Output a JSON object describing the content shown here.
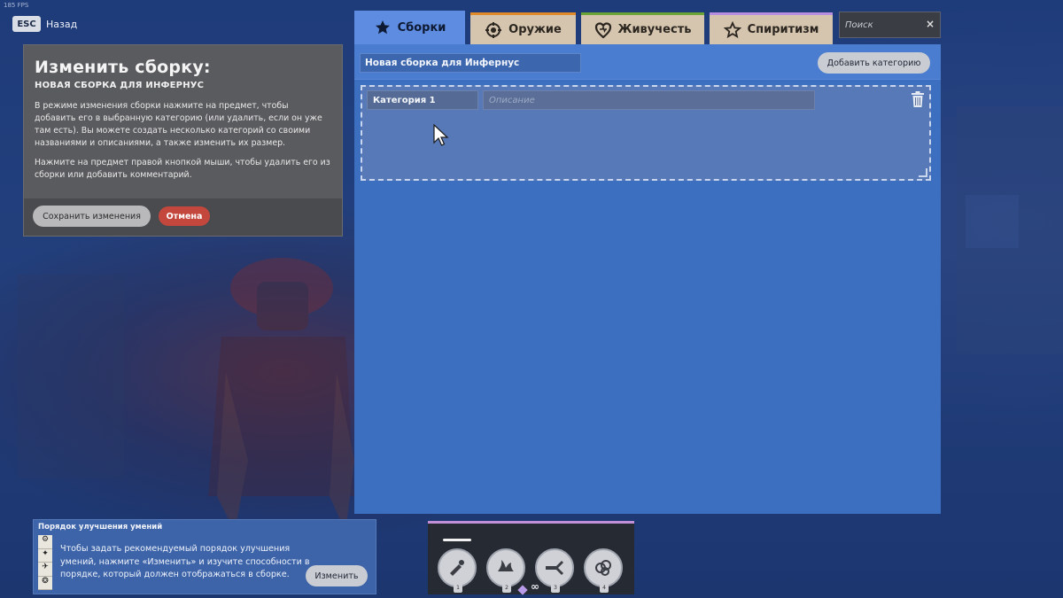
{
  "fps": "185 FPS",
  "back": {
    "key": "ESC",
    "label": "Назад"
  },
  "edit_panel": {
    "title": "Изменить сборку:",
    "subtitle": "НОВАЯ СБОРКА ДЛЯ ИНФЕРНУС",
    "description": "В режиме изменения сборки нажмите на предмет, чтобы добавить его в выбранную категорию (или удалить, если он уже там есть). Вы можете создать несколько категорий со своими названиями и описаниями, а также изменить их размер.",
    "description2": "Нажмите на предмет правой кнопкой мыши, чтобы удалить его из сборки или добавить комментарий.",
    "save_label": "Сохранить изменения",
    "cancel_label": "Отмена"
  },
  "tabs": [
    {
      "label": "Сборки",
      "icon": "star-icon",
      "active": true
    },
    {
      "label": "Оружие",
      "icon": "weapon-icon",
      "accent": "#e08a2a"
    },
    {
      "label": "Живучесть",
      "icon": "vitality-icon",
      "accent": "#6aa536"
    },
    {
      "label": "Спиритизм",
      "icon": "spirit-icon",
      "accent": "#b88fe0"
    }
  ],
  "search": {
    "placeholder": "Поиск",
    "clear": "×"
  },
  "build": {
    "name": "Новая сборка для Инфернус",
    "add_category_label": "Добавить категорию",
    "categories": [
      {
        "name": "Категория 1",
        "description_placeholder": "Описание"
      }
    ]
  },
  "ability_order": {
    "title": "Порядок улучшения умений",
    "text": "Чтобы задать рекомендуемый порядок улучшения умений, нажмите «Изменить» и изучите способности в порядке, который должен отображаться в сборке.",
    "change_label": "Изменить"
  },
  "hero_abilities": {
    "slots": [
      {
        "number": "1",
        "icon": "catalyst-icon"
      },
      {
        "number": "2",
        "icon": "flame-dash-icon"
      },
      {
        "number": "3",
        "icon": "afterburn-icon"
      },
      {
        "number": "4",
        "icon": "concussive-combustion-icon"
      }
    ],
    "infinity": "∞"
  },
  "colors": {
    "main_panel": "#3d6fc1",
    "active_tab": "#5e8ce0",
    "cancel": "#c4473e",
    "weapon": "#e08a2a",
    "vitality": "#6aa536",
    "spirit": "#b88fe0"
  }
}
